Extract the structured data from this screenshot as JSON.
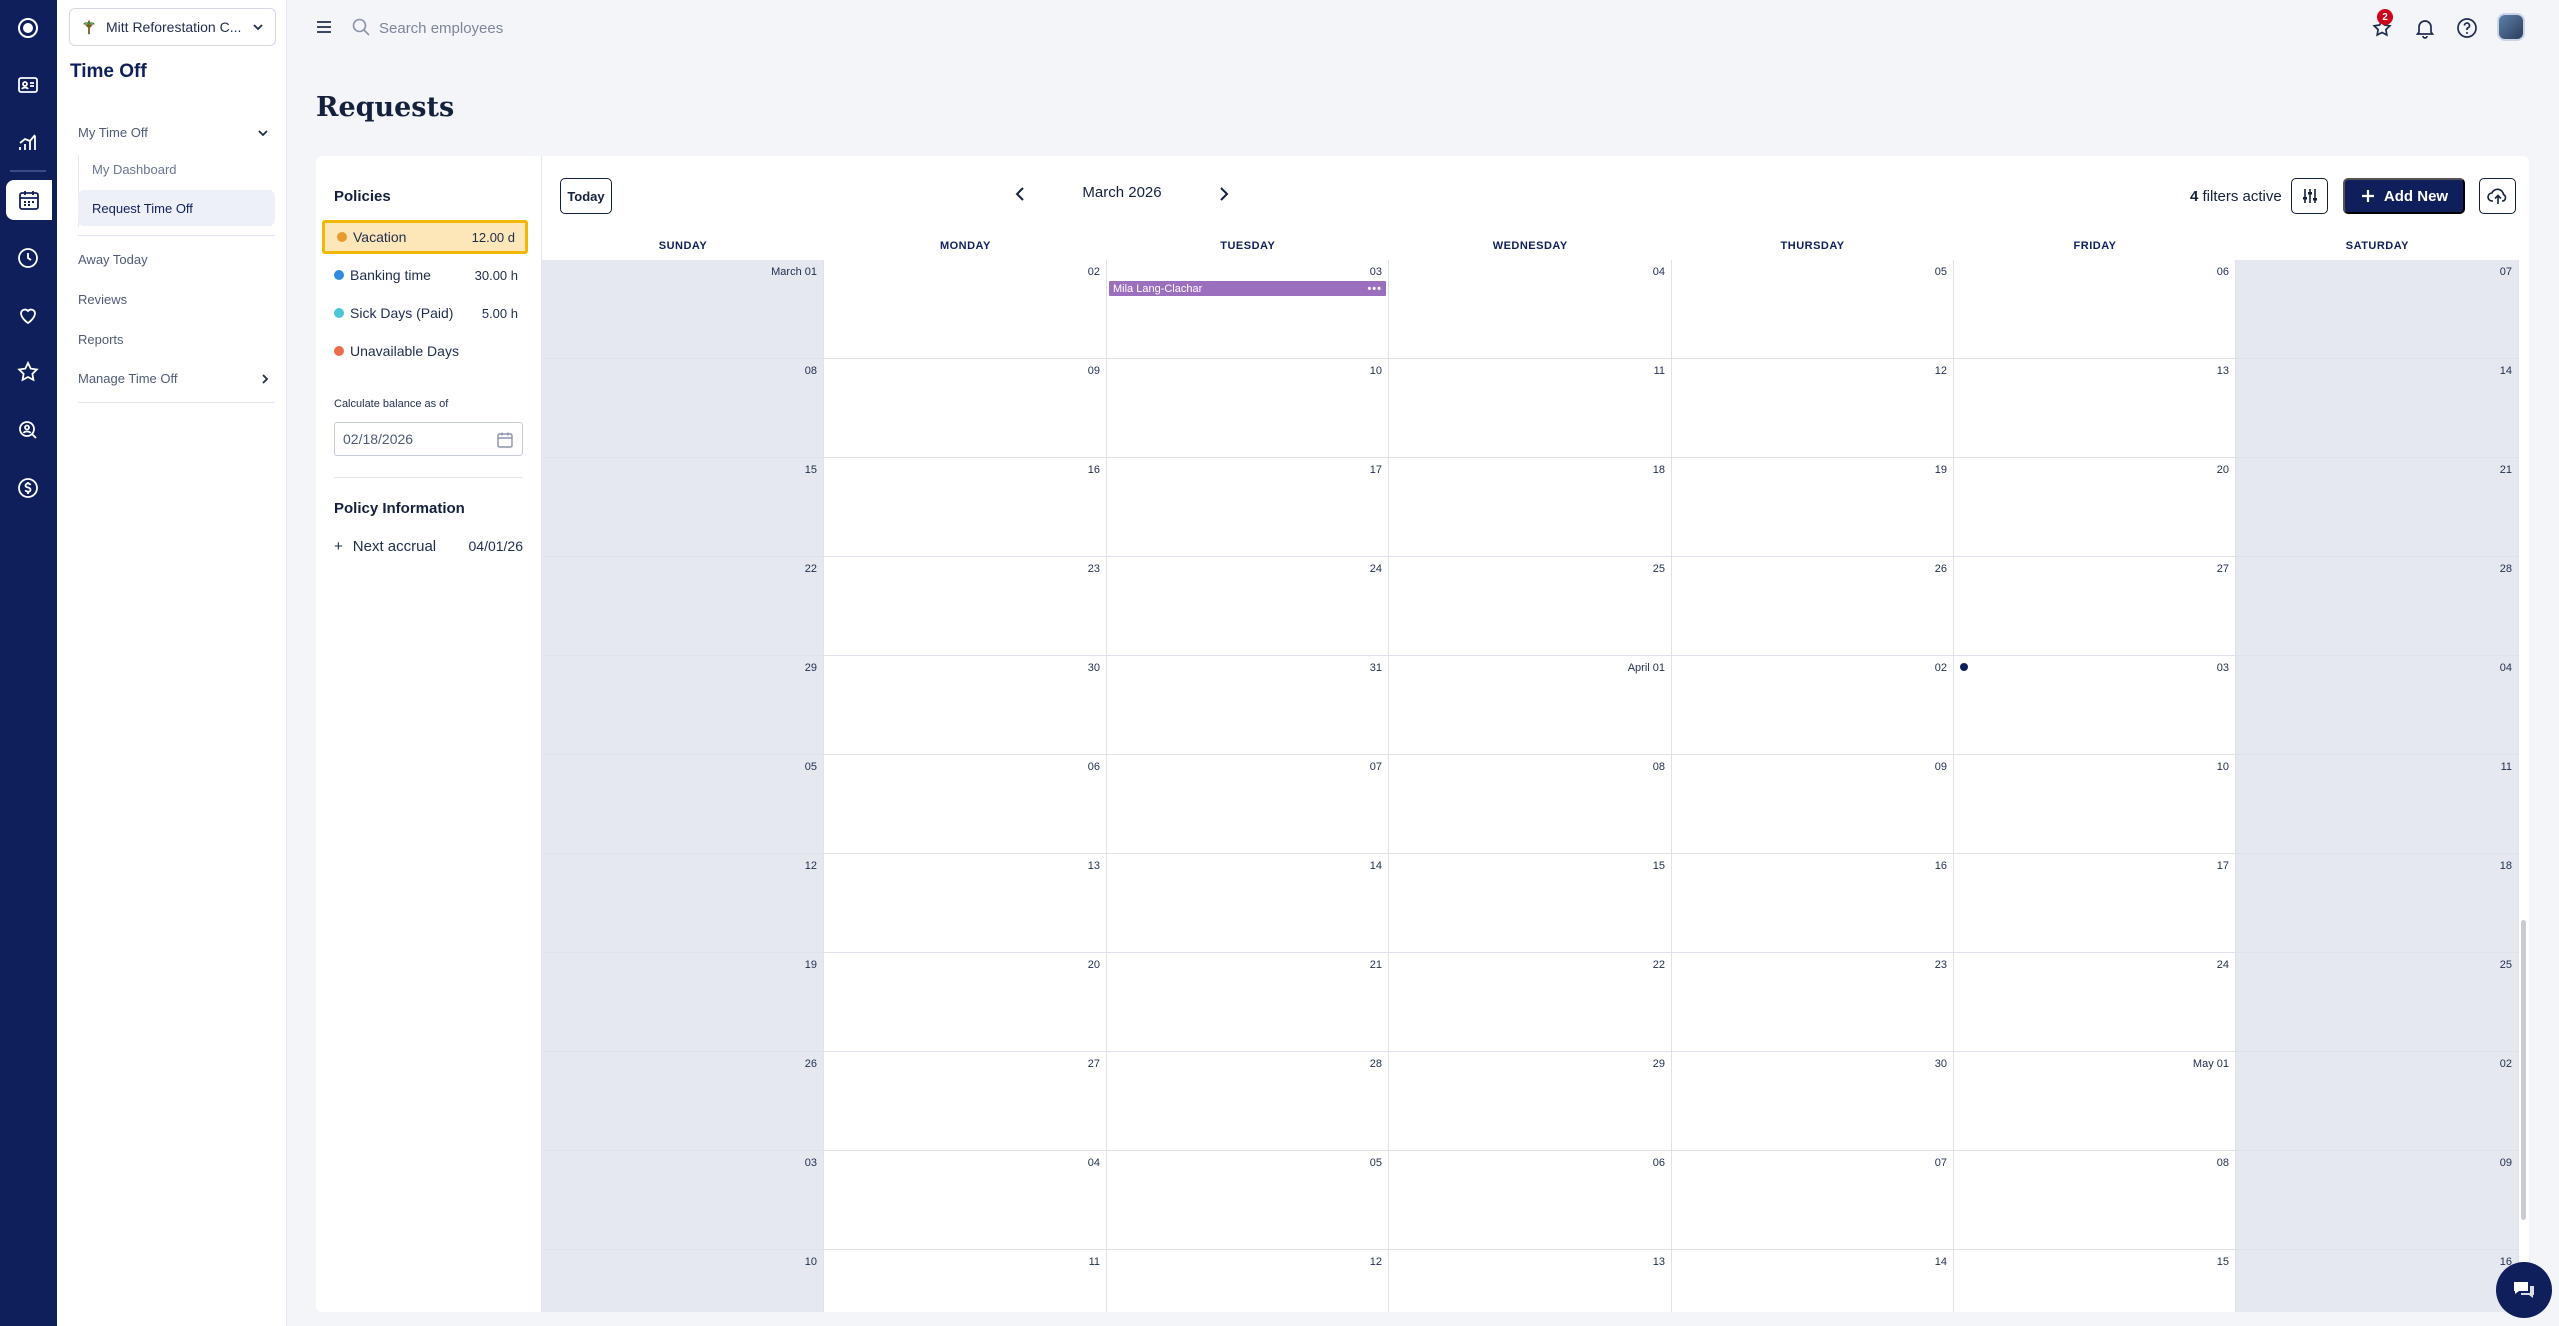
{
  "org": {
    "name": "Mitt Reforestation C..."
  },
  "nav": {
    "title": "Time Off",
    "my_time_off": "My Time Off",
    "my_dashboard": "My Dashboard",
    "request_time_off": "Request Time Off",
    "away_today": "Away Today",
    "reviews": "Reviews",
    "reports": "Reports",
    "manage_time_off": "Manage Time Off"
  },
  "search": {
    "placeholder": "Search employees"
  },
  "notifications": {
    "badge": "2"
  },
  "page": {
    "title": "Requests"
  },
  "policies": {
    "title": "Policies",
    "items": [
      {
        "name": "Vacation",
        "value": "12.00 d",
        "color": "#e89a2e"
      },
      {
        "name": "Banking time",
        "value": "30.00 h",
        "color": "#2f8be0"
      },
      {
        "name": "Sick Days (Paid)",
        "value": "5.00 h",
        "color": "#4cc6d6"
      },
      {
        "name": "Unavailable Days",
        "value": "",
        "color": "#ef6b4a"
      }
    ],
    "calc_label": "Calculate balance as of",
    "calc_date": "02/18/2026"
  },
  "policy_info": {
    "title": "Policy Information",
    "next_accrual_label": "Next accrual",
    "next_accrual_date": "04/01/26"
  },
  "calendar": {
    "today_label": "Today",
    "month_label": "March 2026",
    "filters_count": "4",
    "filters_text": "filters active",
    "add_new_label": "Add New",
    "weekdays": [
      "SUNDAY",
      "MONDAY",
      "TUESDAY",
      "WEDNESDAY",
      "THURSDAY",
      "FRIDAY",
      "SATURDAY"
    ],
    "weeks": [
      [
        "March 01",
        "02",
        "03",
        "04",
        "05",
        "06",
        "07"
      ],
      [
        "08",
        "09",
        "10",
        "11",
        "12",
        "13",
        "14"
      ],
      [
        "15",
        "16",
        "17",
        "18",
        "19",
        "20",
        "21"
      ],
      [
        "22",
        "23",
        "24",
        "25",
        "26",
        "27",
        "28"
      ],
      [
        "29",
        "30",
        "31",
        "April 01",
        "02",
        "03",
        "04"
      ],
      [
        "05",
        "06",
        "07",
        "08",
        "09",
        "10",
        "11"
      ],
      [
        "12",
        "13",
        "14",
        "15",
        "16",
        "17",
        "18"
      ],
      [
        "19",
        "20",
        "21",
        "22",
        "23",
        "24",
        "25"
      ],
      [
        "26",
        "27",
        "28",
        "29",
        "30",
        "May 01",
        "02"
      ],
      [
        "03",
        "04",
        "05",
        "06",
        "07",
        "08",
        "09"
      ],
      [
        "10",
        "11",
        "12",
        "13",
        "14",
        "15",
        "16"
      ]
    ],
    "events": [
      {
        "week": 0,
        "day": 2,
        "label": "Mila Lang-Clachar",
        "more": "•••",
        "color": "#9b6fbd"
      }
    ],
    "markers": [
      {
        "week": 4,
        "day": 5,
        "color": "#0f1f5c"
      }
    ]
  }
}
